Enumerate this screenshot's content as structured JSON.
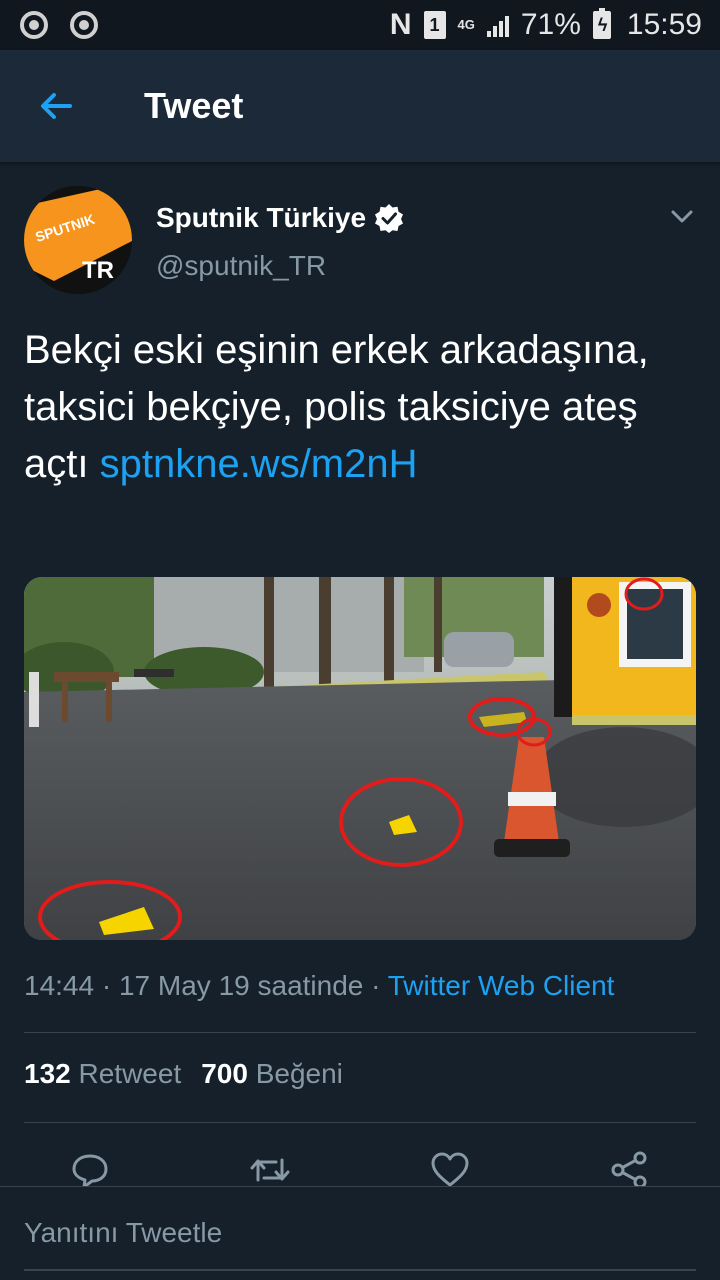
{
  "status_bar": {
    "left_icons": [
      "chrome-icon",
      "chrome-icon"
    ],
    "nfc_label": "N",
    "sim_label": "1",
    "network_label": "4G",
    "battery": "71%",
    "time": "15:59"
  },
  "header": {
    "title": "Tweet"
  },
  "tweet": {
    "author_name": "Sputnik Türkiye",
    "handle": "@sputnik_TR",
    "avatar_text_top": "SPUTNIK",
    "avatar_text_bottom": "TR",
    "text": "Bekçi eski eşinin erkek arkadaşına, taksici bekçiye, polis taksiciye ateş açtı ",
    "link": "sptnkne.ws/m2nH",
    "time": "14:44",
    "date": "17 May 19 saatinde",
    "source": "Twitter Web Client",
    "retweets": "132",
    "retweets_label": "Retweet",
    "likes": "700",
    "likes_label": "Beğeni"
  },
  "actions": [
    "reply-icon",
    "retweet-icon",
    "like-icon",
    "share-icon"
  ],
  "reply": {
    "placeholder": "Yanıtını Tweetle"
  },
  "colors": {
    "background": "#15202b",
    "header": "#1c2938",
    "accent": "#1da1f2",
    "secondary_text": "#8899a6",
    "divider": "#38444d",
    "brand_orange": "#f7941d"
  }
}
